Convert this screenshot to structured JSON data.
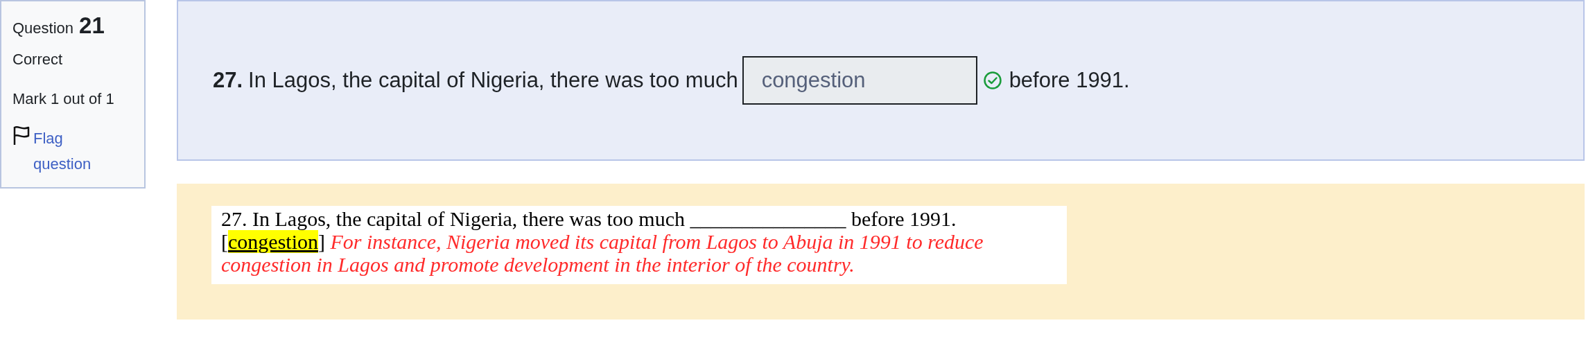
{
  "question_info": {
    "label": "Question",
    "number": "21",
    "state": "Correct",
    "mark": "Mark 1 out of 1",
    "flag_link": "Flag question",
    "flagged": false
  },
  "question": {
    "number": "27.",
    "text_before": "In Lagos, the capital of Nigeria, there was too much",
    "answer": "congestion",
    "correct": true,
    "text_after": "before 1991."
  },
  "feedback": {
    "question_line": "27. In Lagos, the capital of Nigeria, there was too much _______________ before 1991.",
    "bracket_open": "[",
    "answer": "congestion",
    "bracket_close": "]",
    "explanation": "For instance, Nigeria moved its capital from Lagos to Abuja in 1991 to reduce congestion in Lagos and promote development in the interior of the country."
  }
}
